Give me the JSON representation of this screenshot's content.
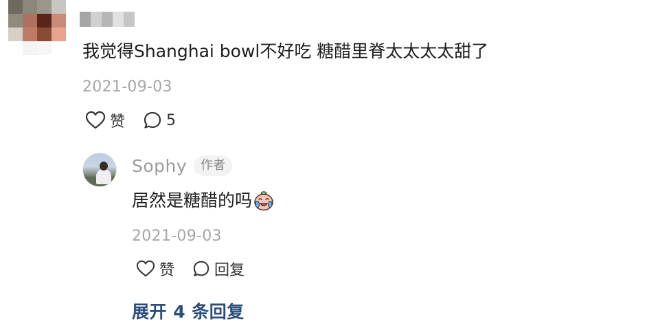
{
  "main_comment": {
    "avatar_pixels": [
      "#6f6a60",
      "#8c877b",
      "#9a968c",
      "#c8c6c0",
      "#8f8a7c",
      "#b07060",
      "#5a2418",
      "#c98b78",
      "#d6d0c6",
      "#c07a68",
      "#8a4a38",
      "#e8a48e",
      "#ffffff",
      "#f4f4f4",
      "#f7f7f7",
      "#ffffff"
    ],
    "username_pixels": [
      "#a5a5a5",
      "#d0d0d0",
      "#b6b6b6",
      "#e1e1e1",
      "#c6c6c6"
    ],
    "text": "我觉得Shanghai bowl不好吃 糖醋里脊太太太太甜了",
    "date": "2021-09-03",
    "like_label": "赞",
    "comment_count": "5"
  },
  "reply": {
    "name": "Sophy",
    "badge": "作者",
    "text": "居然是糖醋的吗",
    "emoji": "crying-face-emoji",
    "date": "2021-09-03",
    "like_label": "赞",
    "reply_label": "回复"
  },
  "expand_replies_label": "展开 4 条回复",
  "colors": {
    "link": "#2b4d7d",
    "meta": "#a6a6a6",
    "text": "#1e1e1e"
  }
}
